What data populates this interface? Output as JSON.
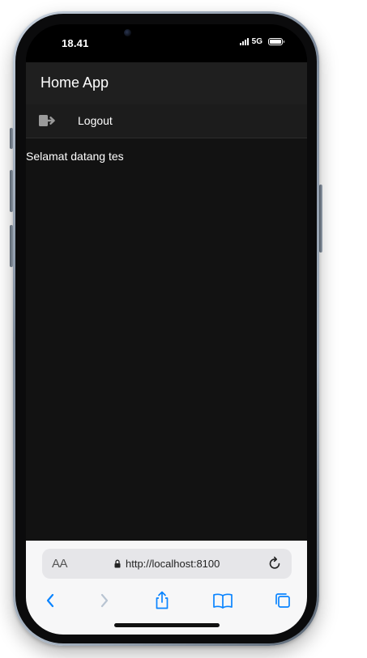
{
  "status_bar": {
    "time": "18.41",
    "network": "5G",
    "icons": [
      "signal-icon",
      "battery-icon"
    ]
  },
  "app": {
    "title": "Home App",
    "menu": [
      {
        "label": "Logout",
        "icon": "logout-icon"
      }
    ],
    "welcome_text": "Selamat datang tes"
  },
  "browser": {
    "text_size_label": "AA",
    "url": "http://localhost:8100",
    "toolbar_icons": [
      "back-icon",
      "forward-icon",
      "share-icon",
      "bookmarks-icon",
      "tabs-icon"
    ]
  },
  "colors": {
    "header_bg": "#1f1f1f",
    "content_bg": "#121212",
    "safari_accent": "#0a84ff"
  }
}
